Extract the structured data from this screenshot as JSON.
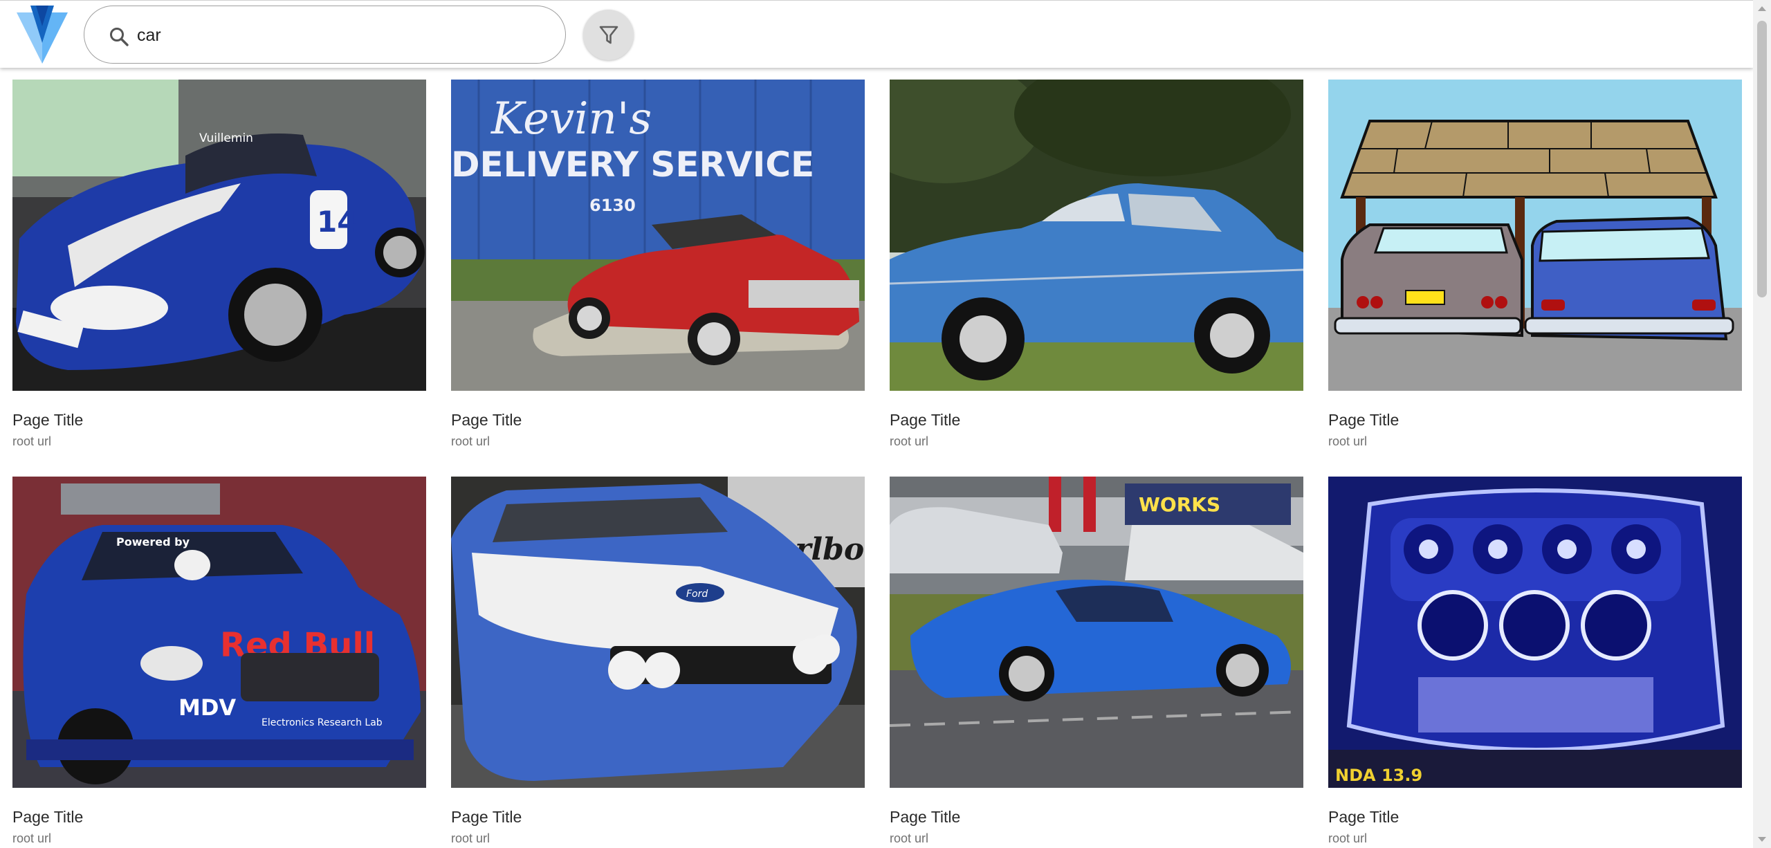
{
  "header": {
    "logo": "vuetify-logo",
    "search": {
      "value": "car",
      "icon": "search-icon"
    },
    "filter_icon": "filter-icon"
  },
  "results": [
    {
      "title": "Page Title",
      "url": "root url",
      "thumb_sign_1": "",
      "thumb_sign_2": "",
      "thumb_plate": "",
      "thumb_number": "14",
      "thumb_logo": "Vuillemin"
    },
    {
      "title": "Page Title",
      "url": "root url",
      "thumb_sign_1": "Kevin's",
      "thumb_sign_2": "DELIVERY SERVICE",
      "thumb_number": "6130"
    },
    {
      "title": "Page Title",
      "url": "root url"
    },
    {
      "title": "Page Title",
      "url": "root url"
    },
    {
      "title": "Page Title",
      "url": "root url",
      "thumb_brand_1": "Red Bull",
      "thumb_brand_2": "MDV",
      "thumb_brand_3": "Electronics Research Lab",
      "thumb_brand_4": "Powered by"
    },
    {
      "title": "Page Title",
      "url": "root url",
      "thumb_brand_1": "Marlboro",
      "thumb_brand_2": "Ford"
    },
    {
      "title": "Page Title",
      "url": "root url",
      "thumb_sign_1": "WORKS"
    },
    {
      "title": "Page Title",
      "url": "root url",
      "thumb_sign_1": "NDA 13.9"
    }
  ]
}
